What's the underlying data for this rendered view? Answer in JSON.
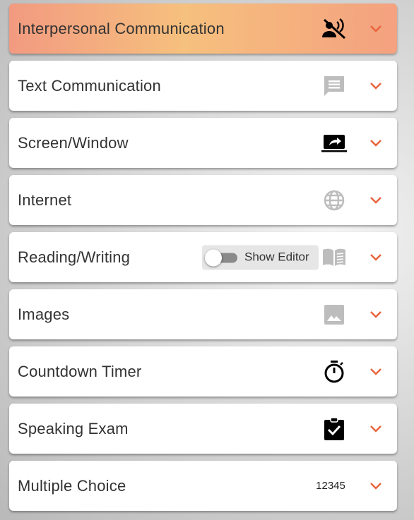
{
  "accent_color": "#e8643c",
  "sections": [
    {
      "label": "Interpersonal Communication",
      "icon": "voice-off-icon",
      "active": true
    },
    {
      "label": "Text Communication",
      "icon": "chat-message-icon"
    },
    {
      "label": "Screen/Window",
      "icon": "screen-share-icon"
    },
    {
      "label": "Internet",
      "icon": "globe-icon"
    },
    {
      "label": "Reading/Writing",
      "icon": "book-icon",
      "toggle": {
        "label": "Show Editor",
        "on": false
      }
    },
    {
      "label": "Images",
      "icon": "image-icon"
    },
    {
      "label": "Countdown Timer",
      "icon": "stopwatch-icon"
    },
    {
      "label": "Speaking Exam",
      "icon": "clipboard-check-icon"
    },
    {
      "label": "Multiple Choice",
      "icon": "numbers-text",
      "icon_text": "12345"
    }
  ]
}
